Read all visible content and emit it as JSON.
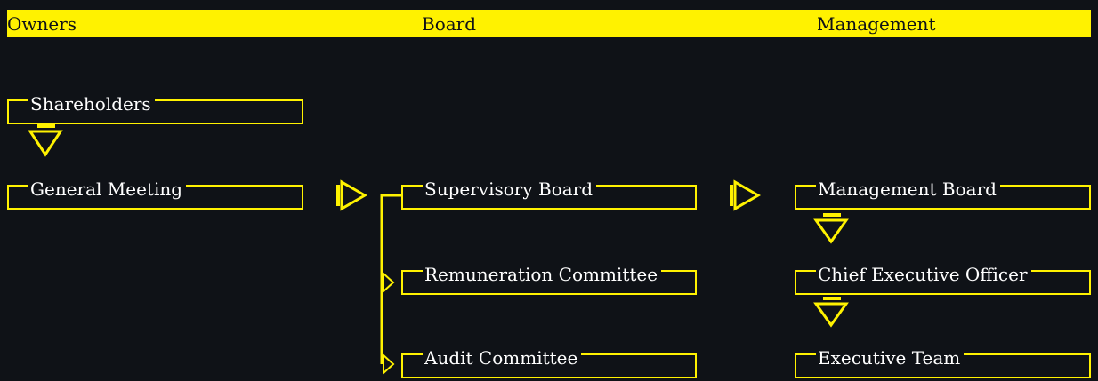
{
  "header": {
    "owners": "Owners",
    "board": "Board",
    "management": "Management"
  },
  "nodes": {
    "shareholders": "Shareholders",
    "general_meeting": "General Meeting",
    "supervisory_board": "Supervisory Board",
    "remuneration_committee": "Remuneration Committee",
    "audit_committee": "Audit Committee",
    "management_board": "Management Board",
    "chief_executive_officer": "Chief Executive Officer",
    "executive_team": "Executive Team"
  },
  "colors": {
    "background": "#0f1217",
    "accent": "#fff200",
    "text": "#ffffff"
  }
}
